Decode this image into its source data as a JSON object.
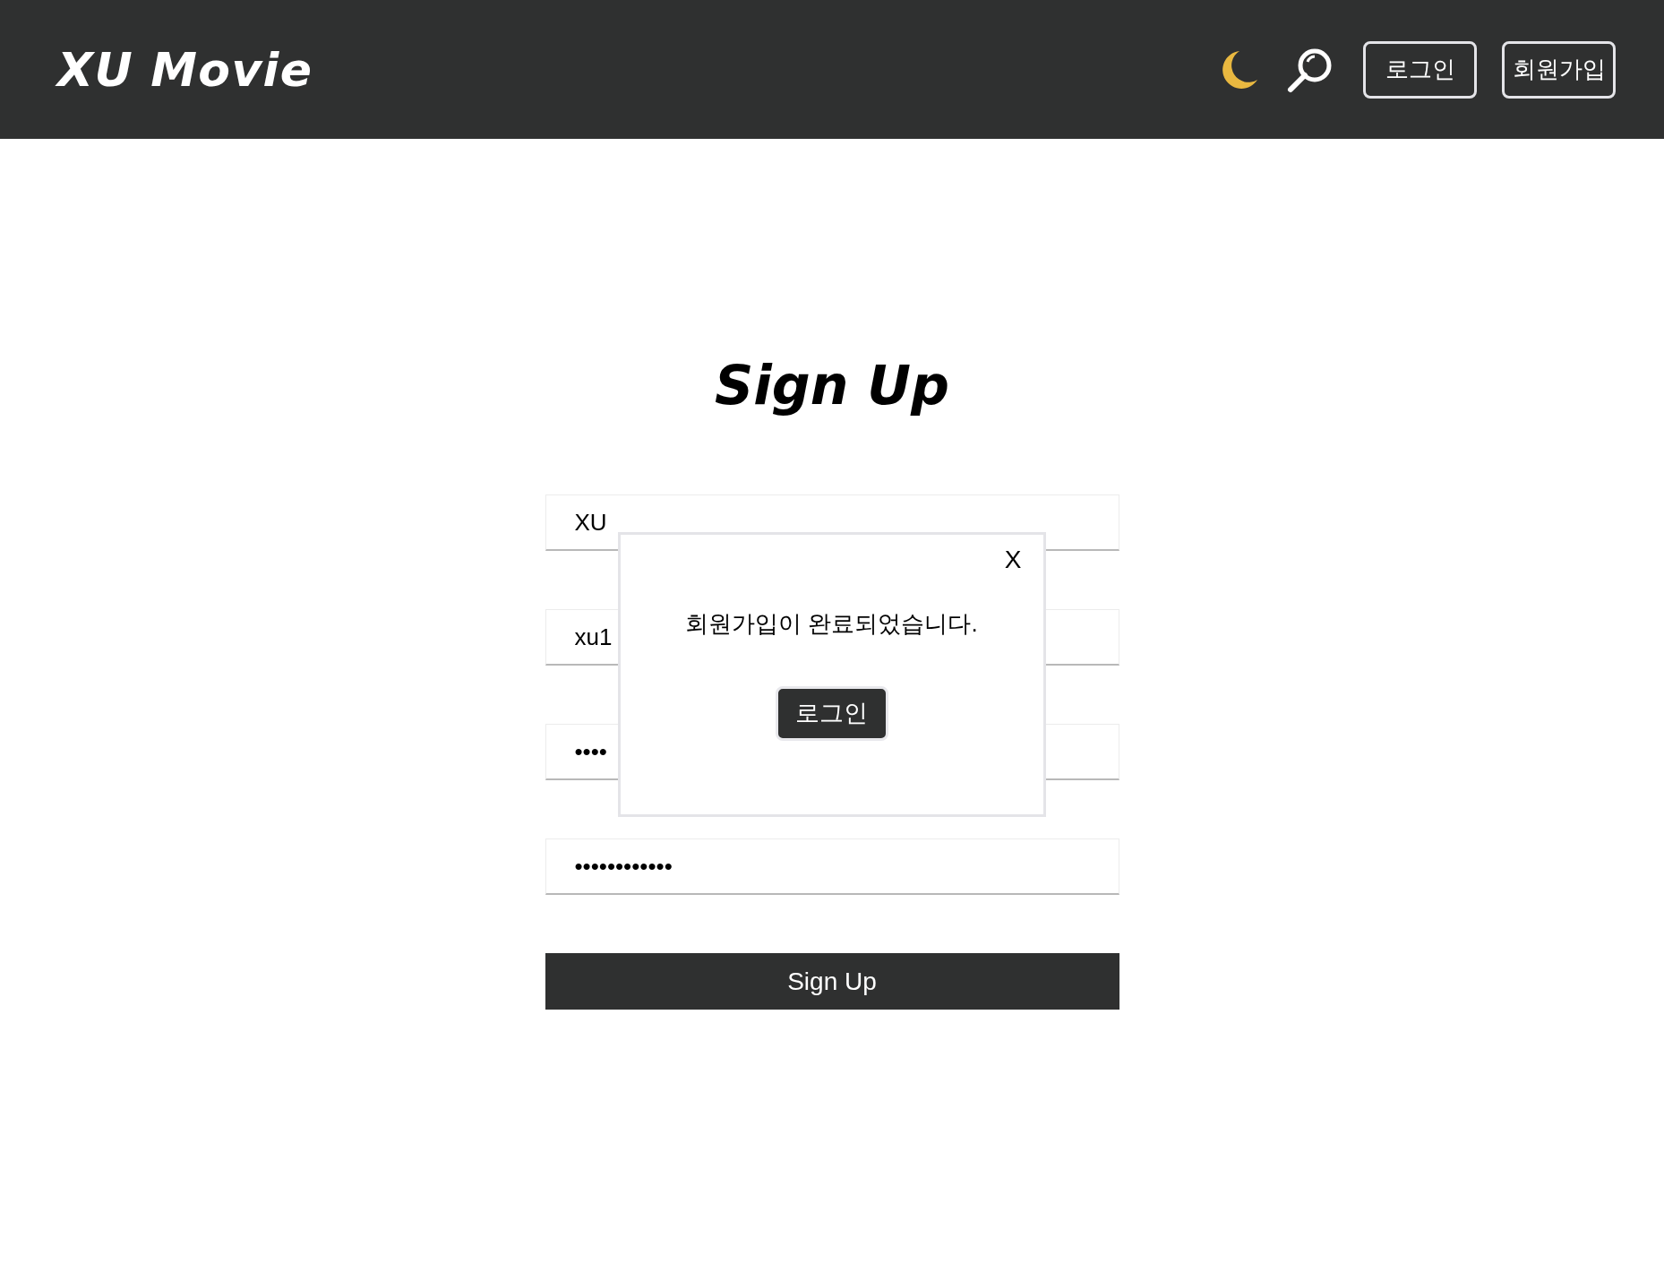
{
  "header": {
    "logo": "XU Movie",
    "buttons": [
      "로그인",
      "회원가입"
    ]
  },
  "title": "Sign Up",
  "fields": [
    {
      "value": "XU"
    },
    {
      "value": "xu1"
    },
    {
      "value": "••••"
    },
    {
      "value": "••••••••••••"
    }
  ],
  "submit_button": "Sign Up",
  "dialog": {
    "close": "X",
    "message": "회원가입이 완료되었습니다.",
    "button": "로그인"
  }
}
